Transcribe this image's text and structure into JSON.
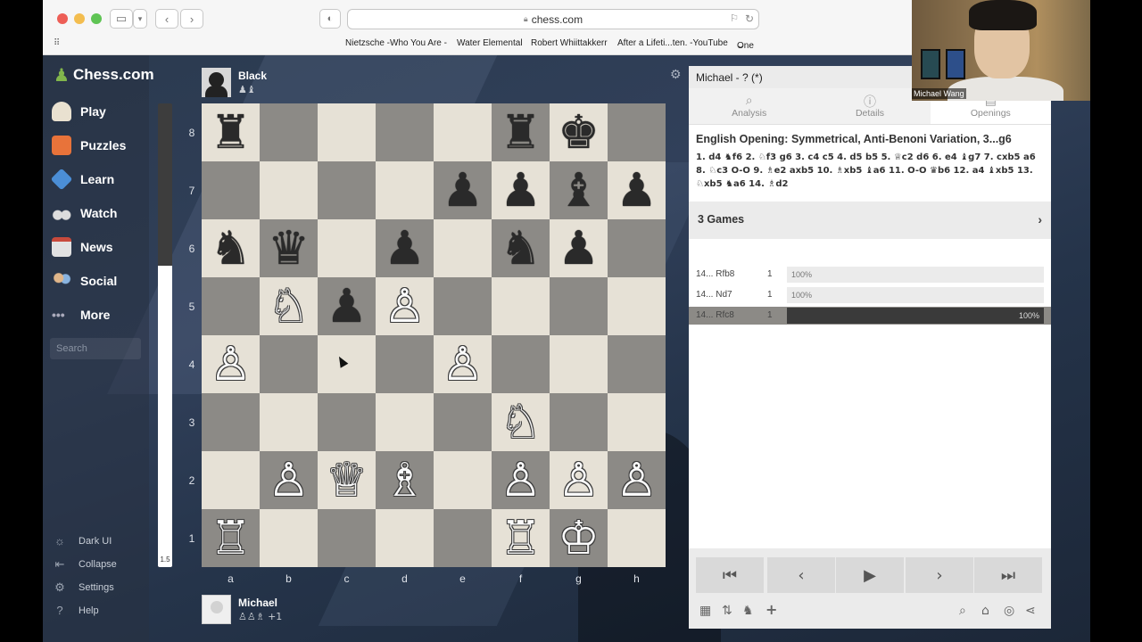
{
  "browser": {
    "url": "chess.com",
    "bookmarks": [
      "Nietzsche -Who You Are -",
      "Water Elemental",
      "Robert Whiittakkerr",
      "After a Lifeti...ten. -YouTube",
      "One"
    ]
  },
  "sidebar": {
    "logo": "Chess.com",
    "items": [
      {
        "label": "Play",
        "icon": "pawn-icon"
      },
      {
        "label": "Puzzles",
        "icon": "puzzle-icon"
      },
      {
        "label": "Learn",
        "icon": "graduation-cap-icon"
      },
      {
        "label": "Watch",
        "icon": "binoculars-icon"
      },
      {
        "label": "News",
        "icon": "newspaper-icon"
      },
      {
        "label": "Social",
        "icon": "people-icon"
      },
      {
        "label": "More",
        "icon": "dots-icon"
      }
    ],
    "search_placeholder": "Search",
    "footer": [
      {
        "label": "Dark UI",
        "icon": "sun-icon"
      },
      {
        "label": "Collapse",
        "icon": "collapse-icon"
      },
      {
        "label": "Settings",
        "icon": "gear-icon"
      },
      {
        "label": "Help",
        "icon": "help-icon"
      }
    ]
  },
  "eval": {
    "value": "1.5",
    "white_fraction": 0.65
  },
  "top_player": {
    "name": "Black",
    "captured": "♟♝"
  },
  "bottom_player": {
    "name": "Michael",
    "captured": "♙♙♗ +1"
  },
  "board": {
    "ranks": [
      "8",
      "7",
      "6",
      "5",
      "4",
      "3",
      "2",
      "1"
    ],
    "files": [
      "a",
      "b",
      "c",
      "d",
      "e",
      "f",
      "g",
      "h"
    ],
    "position": [
      [
        "r",
        "",
        "",
        "",
        "",
        "r",
        "k",
        ""
      ],
      [
        "",
        "",
        "",
        "",
        "p",
        "p",
        "b",
        "p"
      ],
      [
        "n",
        "q",
        "",
        "p",
        "",
        "n",
        "p",
        ""
      ],
      [
        "",
        "N",
        "p",
        "P",
        "",
        "",
        "",
        ""
      ],
      [
        "P",
        "",
        "",
        "",
        "P",
        "",
        "",
        ""
      ],
      [
        "",
        "",
        "",
        "",
        "",
        "N",
        "",
        ""
      ],
      [
        "",
        "P",
        "Q",
        "B",
        "",
        "P",
        "P",
        "P"
      ],
      [
        "R",
        "",
        "",
        "",
        "",
        "R",
        "K",
        ""
      ]
    ]
  },
  "panel": {
    "header": "Michael - ? (*)",
    "tabs": [
      {
        "label": "Analysis",
        "icon": "magnifier-icon"
      },
      {
        "label": "Details",
        "icon": "info-icon"
      },
      {
        "label": "Openings",
        "icon": "book-icon"
      }
    ],
    "opening_name": "English Opening: Symmetrical, Anti-Benoni Variation, 3...g6",
    "opening_moves": "1. d4 ♞f6 2. ♘f3 g6 3. c4 c5 4. d5 b5 5. ♕c2 d6 6. e4 ♝g7 7. cxb5 a6 8. ♘c3 O-O 9. ♗e2 axb5 10. ♗xb5 ♝a6 11. O-O ♛b6 12. a4 ♝xb5 13. ♘xb5 ♞a6 14. ♗d2",
    "games_label": "3 Games",
    "moves": [
      {
        "move": "14... Rfb8",
        "count": "1",
        "pct_label": "100%",
        "pct": 100
      },
      {
        "move": "14... Nd7",
        "count": "1",
        "pct_label": "100%",
        "pct": 100
      },
      {
        "move": "14... Rfc8",
        "count": "1",
        "pct_label": "100%",
        "pct": 100
      }
    ]
  },
  "webcam": {
    "name": "Michael Wang"
  }
}
